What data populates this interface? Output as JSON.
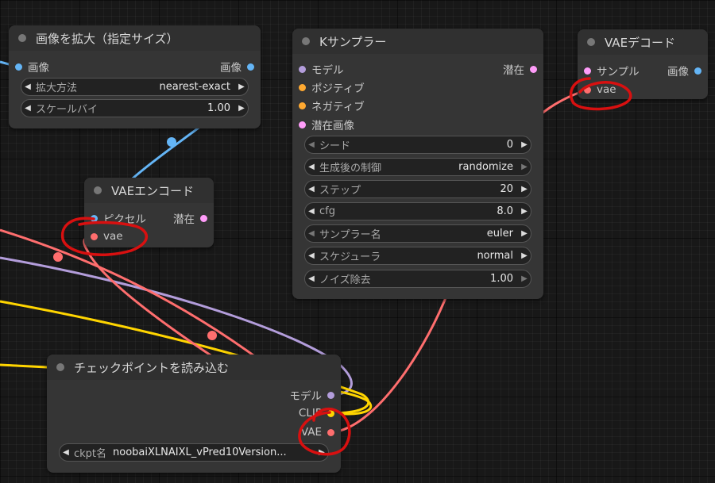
{
  "colors": {
    "image": "#64b5f6",
    "latent": "#ff9cf9",
    "model": "#b39ddb",
    "conditioning": "#ffa931",
    "clip": "#ffd500",
    "vae": "#ff6e6e",
    "annotation": "#d81010"
  },
  "nodes": {
    "upscale": {
      "title": "画像を拡大（指定サイズ）",
      "input": "画像",
      "output": "画像",
      "widgets": [
        {
          "label": "拡大方法",
          "value": "nearest-exact"
        },
        {
          "label": "スケールバイ",
          "value": "1.00"
        }
      ]
    },
    "vae_encode": {
      "title": "VAEエンコード",
      "inputs": [
        "ピクセル",
        "vae"
      ],
      "output": "潜在"
    },
    "ksampler": {
      "title": "Kサンプラー",
      "inputs": [
        "モデル",
        "ポジティブ",
        "ネガティブ",
        "潜在画像"
      ],
      "output": "潜在",
      "widgets": [
        {
          "label": "シード",
          "value": "0"
        },
        {
          "label": "生成後の制御",
          "value": "randomize"
        },
        {
          "label": "ステップ",
          "value": "20"
        },
        {
          "label": "cfg",
          "value": "8.0"
        },
        {
          "label": "サンプラー名",
          "value": "euler"
        },
        {
          "label": "スケジューラ",
          "value": "normal"
        },
        {
          "label": "ノイズ除去",
          "value": "1.00"
        }
      ]
    },
    "vae_decode": {
      "title": "VAEデコード",
      "inputs": [
        "サンプル",
        "vae"
      ],
      "output": "画像"
    },
    "checkpoint": {
      "title": "チェックポイントを読み込む",
      "outputs": [
        "モデル",
        "CLIP",
        "VAE"
      ],
      "widget": {
        "label": "ckpt名",
        "value": "noobaiXLNAIXL_vPred10Version..."
      }
    }
  }
}
